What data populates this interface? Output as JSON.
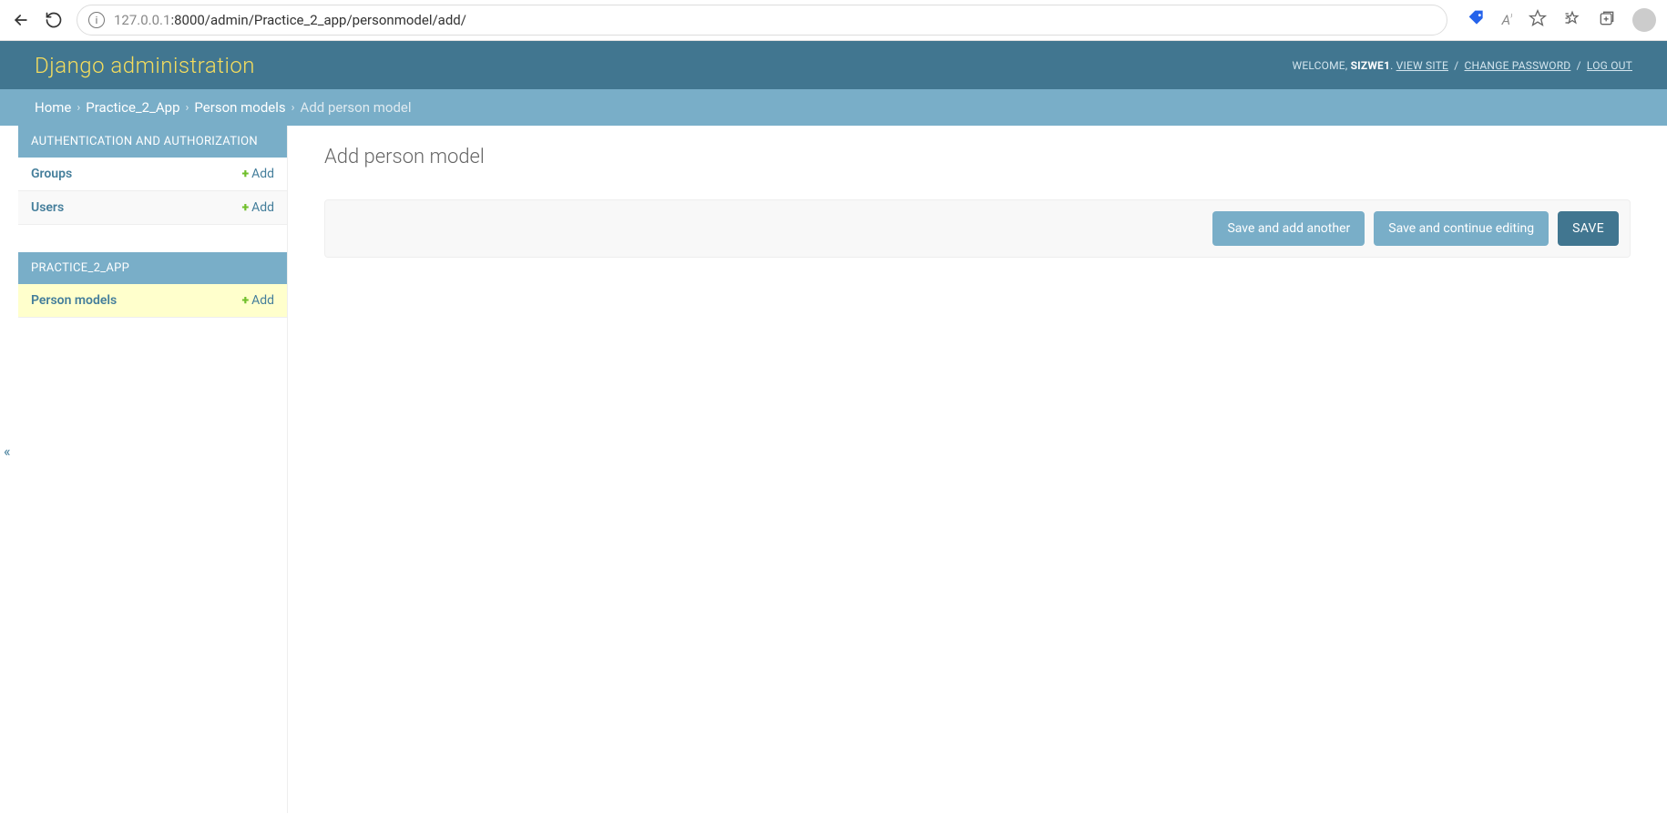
{
  "browser": {
    "url_host": "127.0.0.1",
    "url_port_path": ":8000/admin/Practice_2_app/personmodel/add/"
  },
  "header": {
    "brand": "Django administration",
    "welcome": "WELCOME, ",
    "username": "SIZWE1",
    "view_site": "VIEW SITE",
    "change_password": "CHANGE PASSWORD",
    "log_out": "LOG OUT"
  },
  "breadcrumb": {
    "home": "Home",
    "app": "Practice_2_App",
    "model": "Person models",
    "current": "Add person model"
  },
  "sidebar": {
    "collapse_glyph": "«",
    "auth": {
      "title": "AUTHENTICATION AND AUTHORIZATION",
      "rows": [
        {
          "label": "Groups",
          "add": "Add"
        },
        {
          "label": "Users",
          "add": "Add"
        }
      ]
    },
    "app": {
      "title": "PRACTICE_2_APP",
      "rows": [
        {
          "label": "Person models",
          "add": "Add"
        }
      ]
    }
  },
  "content": {
    "title": "Add person model",
    "buttons": {
      "save_add_another": "Save and add another",
      "save_continue": "Save and continue editing",
      "save": "SAVE"
    }
  }
}
